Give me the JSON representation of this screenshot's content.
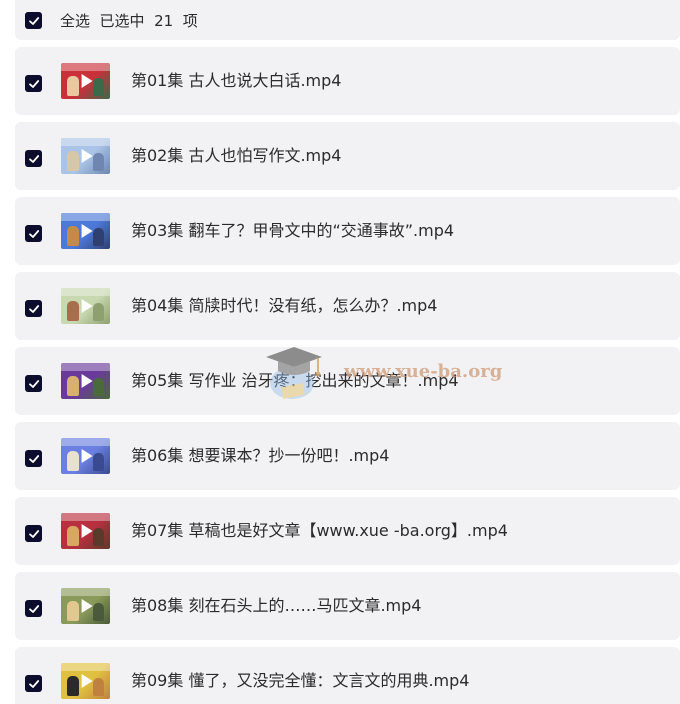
{
  "header": {
    "select_all_label": "全选  已选中  21  项"
  },
  "colors": {
    "accent": "#0c0c2c",
    "row_bg": "#f2f2f4"
  },
  "items": [
    {
      "name": "第01集 古人也说大白话.mp4",
      "thumb": [
        "#c9303a",
        "#e8c9a0",
        "#3a6a4a"
      ]
    },
    {
      "name": "第02集 古人也怕写作文.mp4",
      "thumb": [
        "#a9c4e6",
        "#d7c6a8",
        "#6f86b0"
      ]
    },
    {
      "name": "第03集 翻车了？甲骨文中的“交通事故”.mp4",
      "thumb": [
        "#4c78d8",
        "#c48a4a",
        "#2f3f70"
      ]
    },
    {
      "name": "第04集 简牍时代！没有纸，怎么办？.mp4",
      "thumb": [
        "#c8d8b0",
        "#a86d4a",
        "#8fa070"
      ]
    },
    {
      "name": "第05集 写作业 治牙疼：挖出来的文章！.mp4",
      "thumb": [
        "#6a3a9a",
        "#d8b070",
        "#4a6a3a"
      ]
    },
    {
      "name": "第06集 想要课本？抄一份吧！.mp4",
      "thumb": [
        "#6a7fe0",
        "#e8e0d0",
        "#3a4a90"
      ]
    },
    {
      "name": "第07集 草稿也是好文章【www.xue -ba.org】.mp4",
      "thumb": [
        "#b83040",
        "#d8a860",
        "#5a3a2a"
      ]
    },
    {
      "name": "第08集 刻在石头上的……马匹文章.mp4",
      "thumb": [
        "#8a9a5a",
        "#e0c890",
        "#4a5a3a"
      ]
    },
    {
      "name": "第09集 懂了，又没完全懂：文言文的用典.mp4",
      "thumb": [
        "#e0c040",
        "#2a2a2a",
        "#c08040"
      ]
    }
  ],
  "watermark": {
    "text": "www.xue-ba.org",
    "icon": "graduation-cap-icon"
  }
}
